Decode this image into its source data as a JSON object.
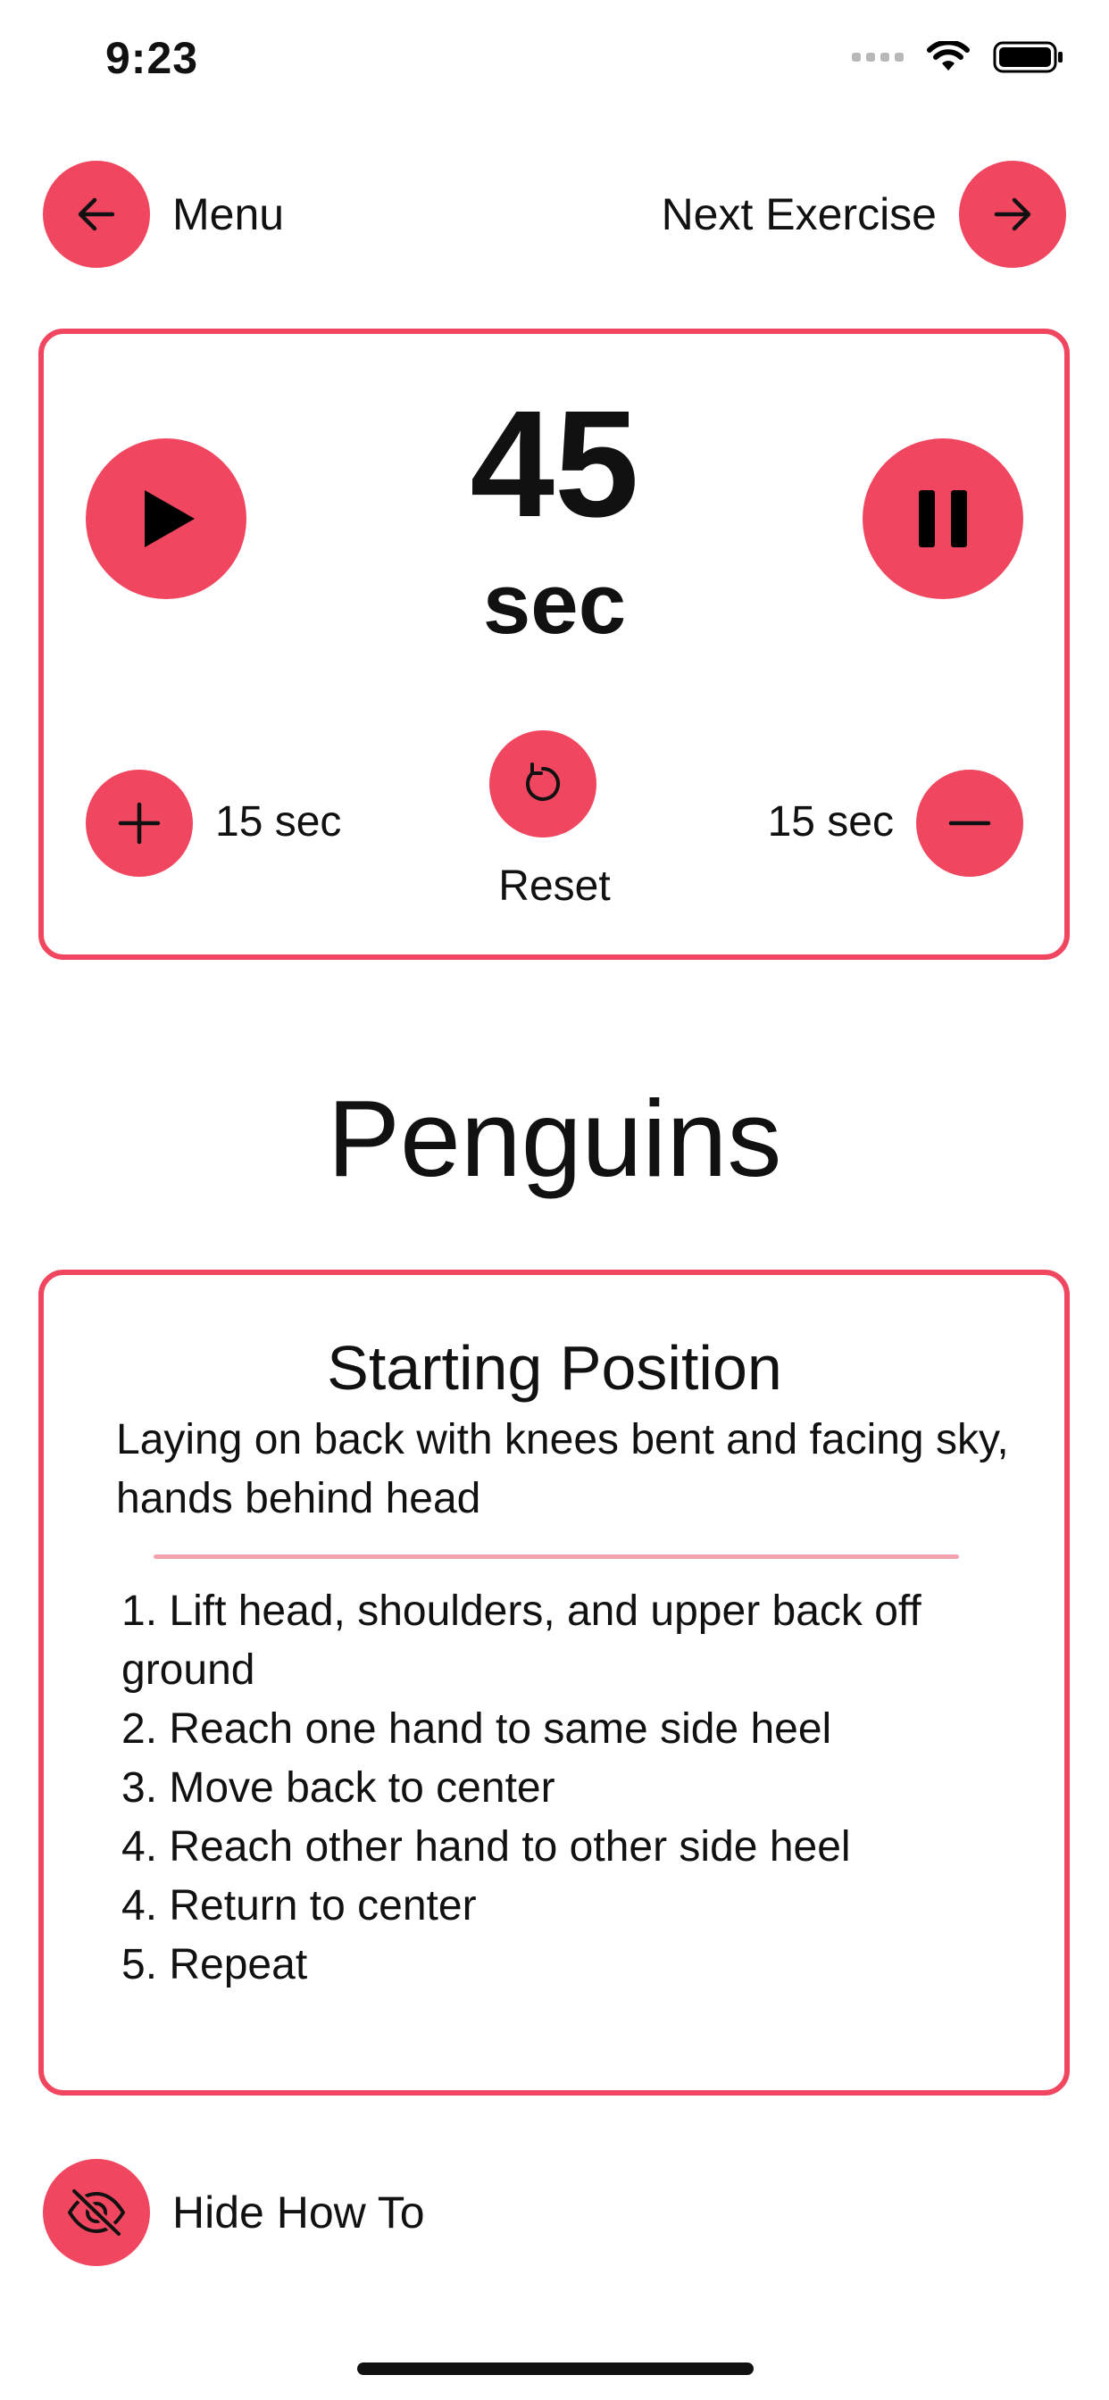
{
  "status_bar": {
    "time": "9:23",
    "icons": [
      "cellular-signal-icon",
      "wifi-icon",
      "battery-icon"
    ]
  },
  "nav": {
    "back_label": "Menu",
    "next_label": "Next Exercise"
  },
  "timer": {
    "value": "45",
    "unit": "sec",
    "add_label": "15 sec",
    "subtract_label": "15 sec",
    "reset_label": "Reset"
  },
  "exercise": {
    "title": "Penguins"
  },
  "how_to": {
    "heading": "Starting Position",
    "description": "Laying on back with knees bent and facing sky, hands behind head",
    "steps": [
      "1. Lift head, shoulders, and upper back off ground",
      "2. Reach one hand to same side heel",
      "3. Move back to center",
      "4. Reach other hand to other side heel",
      "4. Return to center",
      "5. Repeat"
    ]
  },
  "toggle": {
    "hide_label": "Hide How To"
  },
  "colors": {
    "accent": "#F0465F",
    "divider": "#F4A3AE"
  }
}
